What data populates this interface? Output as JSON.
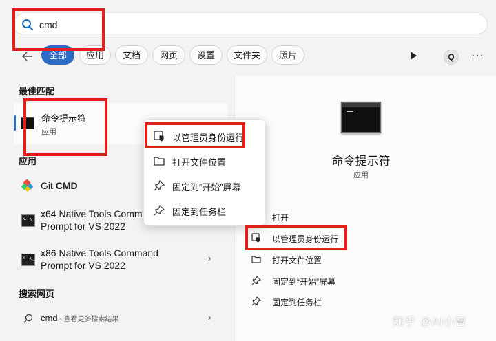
{
  "search": {
    "query": "cmd"
  },
  "filters": [
    "全部",
    "应用",
    "文档",
    "网页",
    "设置",
    "文件夹",
    "照片"
  ],
  "toolbar": {
    "q_label": "Q",
    "more_label": "···"
  },
  "best_match": {
    "section_title": "最佳匹配",
    "name": "命令提示符",
    "type": "应用"
  },
  "apps": {
    "section_title": "应用",
    "items": [
      {
        "name_normal": "Git ",
        "name_bold": "CMD"
      },
      {
        "line1": "x64 Native Tools Comm",
        "line2": "Prompt for VS 2022",
        "icon_text": "C:\\_"
      },
      {
        "line1": "x86 Native Tools Command",
        "line2": "Prompt for VS 2022",
        "icon_text": "C:\\_"
      }
    ]
  },
  "web": {
    "section_title": "搜索网页",
    "query": "cmd",
    "hint": " - 查看更多搜索结果"
  },
  "context_menu": {
    "items": [
      {
        "label": "以管理员身份运行",
        "icon": "admin-shield-icon"
      },
      {
        "label": "打开文件位置",
        "icon": "folder-icon"
      },
      {
        "label": "固定到“开始”屏幕",
        "icon": "pin-icon"
      },
      {
        "label": "固定到任务栏",
        "icon": "pin-icon"
      }
    ]
  },
  "detail": {
    "title": "命令提示符",
    "subtitle": "应用",
    "actions": [
      {
        "label": "打开",
        "icon": "open-icon"
      },
      {
        "label": "以管理员身份运行",
        "icon": "admin-shield-icon"
      },
      {
        "label": "打开文件位置",
        "icon": "folder-icon"
      },
      {
        "label": "固定到“开始”屏幕",
        "icon": "pin-icon"
      },
      {
        "label": "固定到任务栏",
        "icon": "pin-icon"
      }
    ]
  },
  "watermark": "知乎 @AI小智",
  "colors": {
    "accent": "#2b6cc4",
    "highlight": "#e0201b"
  }
}
